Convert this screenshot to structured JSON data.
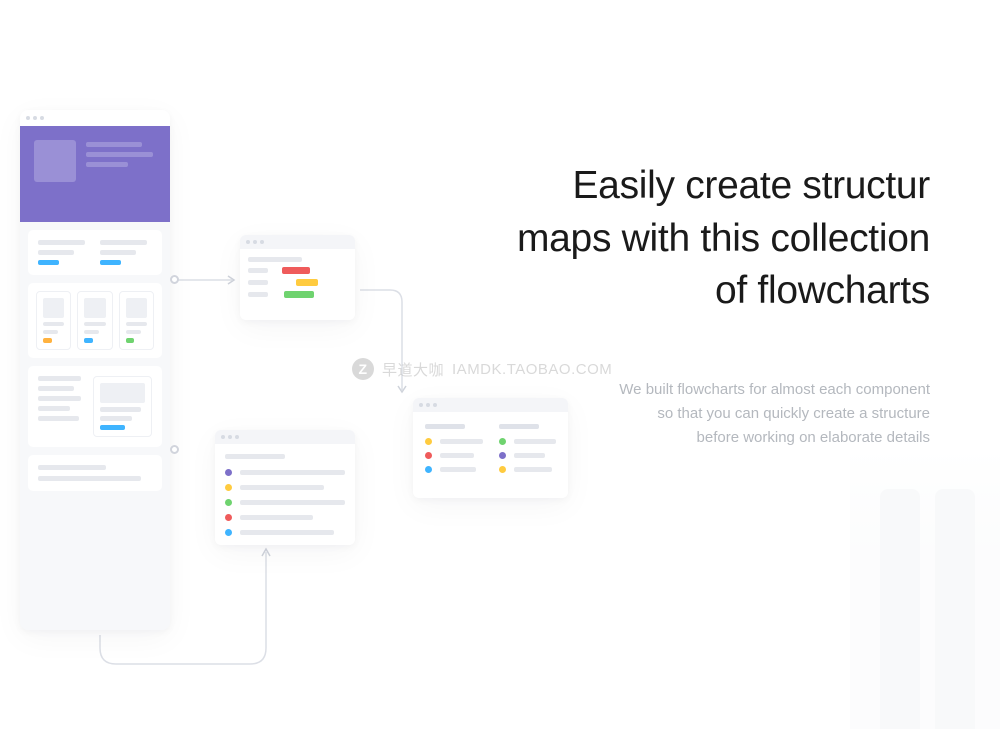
{
  "hero": {
    "title_line1": "Easily create structur",
    "title_line2": "maps with this collection",
    "title_line3": "of flowcharts",
    "subtitle_line1": "We built flowcharts for almost each component",
    "subtitle_line2": "so that you can quickly create a structure",
    "subtitle_line3": "before working on elaborate details"
  },
  "watermark": {
    "badge_letter": "Z",
    "text_cn": "早道大咖",
    "text_url": "IAMDK.TAOBAO.COM"
  },
  "colors": {
    "purple": "#7d70c9",
    "blue": "#3fb4ff",
    "red": "#ef5b5b",
    "yellow": "#ffcb3f",
    "green": "#6fd36f",
    "orange": "#ffb23f",
    "grey_line": "#e6e8ed"
  }
}
